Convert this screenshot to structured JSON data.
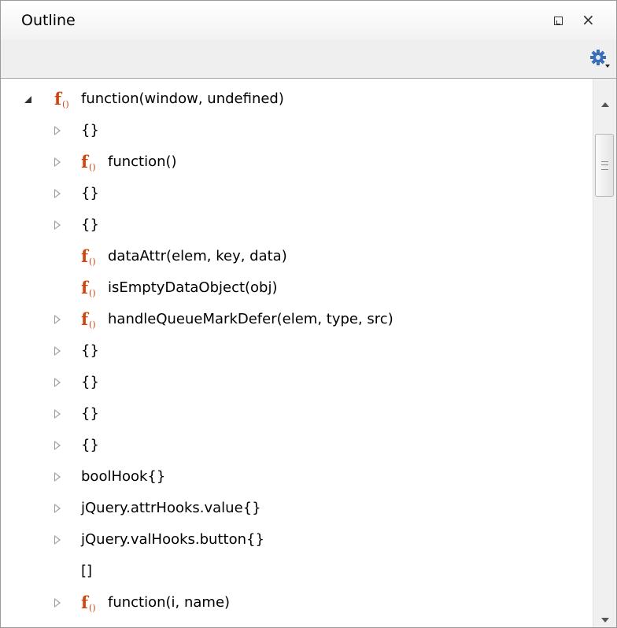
{
  "panel": {
    "title": "Outline",
    "restore_icon": "restore-icon",
    "close_symbol": "×",
    "settings_icon": "gear-icon"
  },
  "function_icon": {
    "letter": "f",
    "parens": "()",
    "color": "#d0450c"
  },
  "tree": {
    "items": [
      {
        "label": "function(window, undefined)",
        "func": true,
        "expander": "expanded",
        "depth": 0
      },
      {
        "label": "{}",
        "func": false,
        "expander": "collapsed",
        "depth": 1
      },
      {
        "label": "function()",
        "func": true,
        "expander": "collapsed",
        "depth": 1
      },
      {
        "label": "{}",
        "func": false,
        "expander": "collapsed",
        "depth": 1
      },
      {
        "label": "{}",
        "func": false,
        "expander": "collapsed",
        "depth": 1
      },
      {
        "label": "dataAttr(elem, key, data)",
        "func": true,
        "expander": "none",
        "depth": 1
      },
      {
        "label": "isEmptyDataObject(obj)",
        "func": true,
        "expander": "none",
        "depth": 1
      },
      {
        "label": "handleQueueMarkDefer(elem, type, src)",
        "func": true,
        "expander": "collapsed",
        "depth": 1
      },
      {
        "label": "{}",
        "func": false,
        "expander": "collapsed",
        "depth": 1
      },
      {
        "label": "{}",
        "func": false,
        "expander": "collapsed",
        "depth": 1
      },
      {
        "label": "{}",
        "func": false,
        "expander": "collapsed",
        "depth": 1
      },
      {
        "label": "{}",
        "func": false,
        "expander": "collapsed",
        "depth": 1
      },
      {
        "label": "boolHook{}",
        "func": false,
        "expander": "collapsed",
        "depth": 1
      },
      {
        "label": "jQuery.attrHooks.value{}",
        "func": false,
        "expander": "collapsed",
        "depth": 1
      },
      {
        "label": "jQuery.valHooks.button{}",
        "func": false,
        "expander": "collapsed",
        "depth": 1
      },
      {
        "label": "[]",
        "func": false,
        "expander": "none",
        "depth": 1
      },
      {
        "label": "function(i, name)",
        "func": true,
        "expander": "collapsed",
        "depth": 1
      },
      {
        "label": "[]",
        "func": false,
        "expander": "none",
        "depth": 1
      }
    ]
  }
}
